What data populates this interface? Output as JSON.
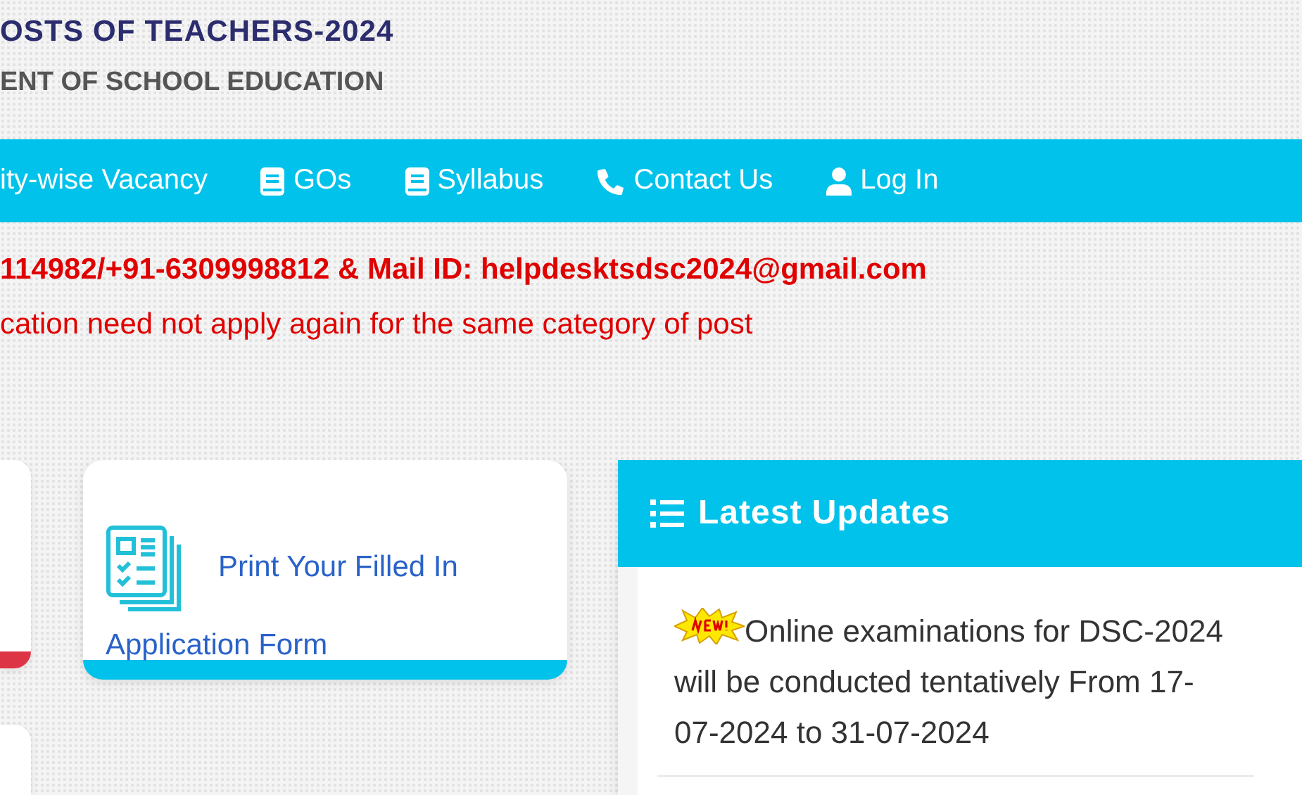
{
  "header": {
    "title": "OSTS OF TEACHERS-2024",
    "subtitle": "ENT OF SCHOOL EDUCATION"
  },
  "nav": [
    {
      "label": "ity-wise Vacancy"
    },
    {
      "label": "GOs"
    },
    {
      "label": "Syllabus"
    },
    {
      "label": "Contact Us"
    },
    {
      "label": "Log In"
    }
  ],
  "notices": [
    {
      "kind": "bold",
      "text": "114982/+91-6309998812 & Mail ID: helpdesktsdsc2024@gmail.com"
    },
    {
      "kind": "plain",
      "text": "cation need not apply again for the same category of post"
    }
  ],
  "side_cards": [
    {
      "kind": "edge",
      "color": "#dc3545"
    },
    {
      "kind": "edge"
    }
  ],
  "action_card": {
    "label": "Print Your Filled In Application Form",
    "color": "#00c2ea"
  },
  "updates": {
    "title": "Latest Updates",
    "items": [
      {
        "new": true,
        "text": "Online examinations for DSC-2024 will be conducted tentatively From 17-07-2024 to 31-07-2024"
      }
    ]
  }
}
